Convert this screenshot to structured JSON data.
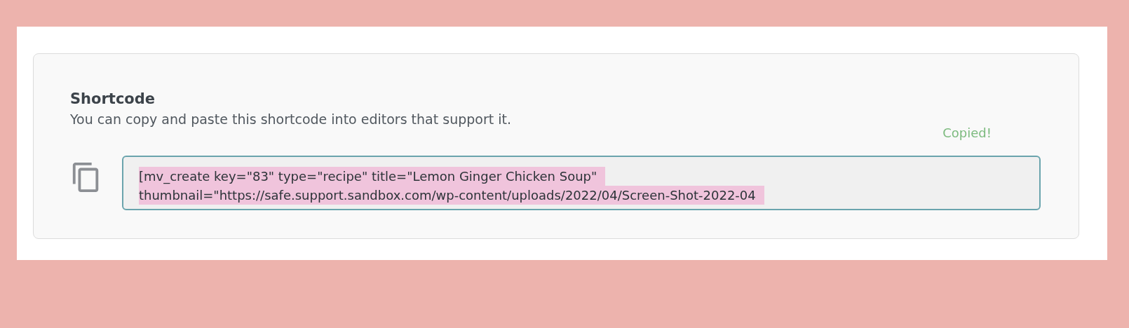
{
  "section": {
    "title": "Shortcode",
    "description": "You can copy and paste this shortcode into editors that support it.",
    "status": "Copied!",
    "shortcode_lines": [
      "[mv_create key=\"83\" type=\"recipe\" title=\"Lemon Ginger Chicken Soup\"",
      "thumbnail=\"https://safe.support.sandbox.com/wp-content/uploads/2022/04/Screen-Shot-2022-04"
    ],
    "selected": true
  }
}
